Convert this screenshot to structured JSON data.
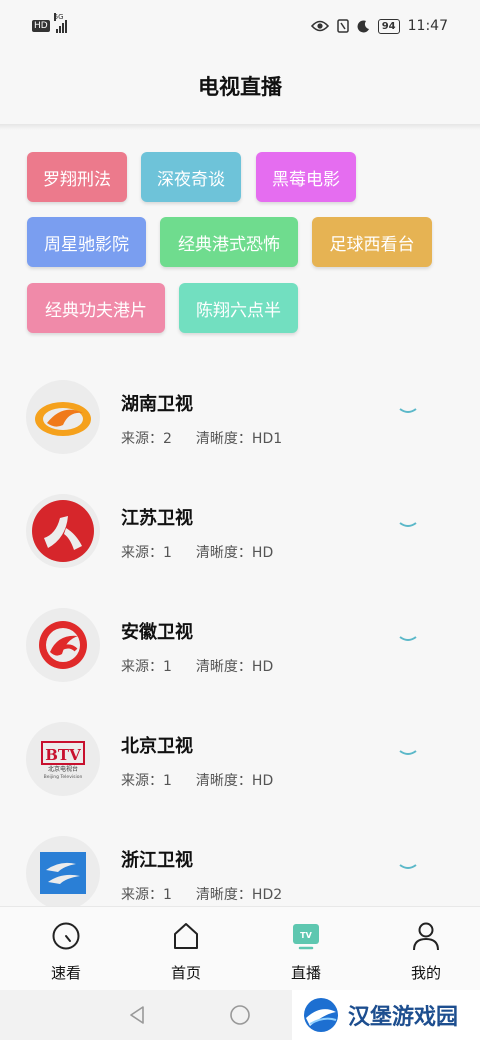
{
  "status_bar": {
    "network_badge": "HD",
    "network_type": "5G",
    "battery": "94",
    "time": "11:47"
  },
  "header": {
    "title": "电视直播"
  },
  "tags": [
    {
      "label": "罗翔刑法",
      "color": "#ec7a8c"
    },
    {
      "label": "深夜奇谈",
      "color": "#6ec3d9"
    },
    {
      "label": "黑莓电影",
      "color": "#e56df0"
    },
    {
      "label": "周星驰影院",
      "color": "#7a9ef0"
    },
    {
      "label": "经典港式恐怖",
      "color": "#6fdc8e"
    },
    {
      "label": "足球西看台",
      "color": "#e6b353"
    },
    {
      "label": "经典功夫港片",
      "color": "#f08aa9"
    },
    {
      "label": "陈翔六点半",
      "color": "#72dfc0"
    }
  ],
  "channels": [
    {
      "name": "湖南卫视",
      "source_label": "来源：",
      "source": "2",
      "quality_label": "清晰度：",
      "quality": "HD1",
      "logo": "hunan-tv-logo"
    },
    {
      "name": "江苏卫视",
      "source_label": "来源：",
      "source": "1",
      "quality_label": "清晰度：",
      "quality": "HD",
      "logo": "jiangsu-tv-logo"
    },
    {
      "name": "安徽卫视",
      "source_label": "来源：",
      "source": "1",
      "quality_label": "清晰度：",
      "quality": "HD",
      "logo": "anhui-tv-logo"
    },
    {
      "name": "北京卫视",
      "source_label": "来源：",
      "source": "1",
      "quality_label": "清晰度：",
      "quality": "HD",
      "logo": "beijing-tv-logo",
      "logo_text": {
        "brand": "BTV",
        "cn": "北京电视台",
        "en": "Beijing Television"
      }
    },
    {
      "name": "浙江卫视",
      "source_label": "来源：",
      "source": "1",
      "quality_label": "清晰度：",
      "quality": "HD2",
      "logo": "zhejiang-tv-logo"
    }
  ],
  "tabbar": {
    "tabs": [
      {
        "label": "速看",
        "icon": "clock-icon"
      },
      {
        "label": "首页",
        "icon": "home-icon"
      },
      {
        "label": "直播",
        "icon": "tv-icon",
        "active": true
      },
      {
        "label": "我的",
        "icon": "user-icon"
      }
    ]
  },
  "watermark": {
    "text": "汉堡游戏园"
  },
  "colors": {
    "accent": "#5ec7b0",
    "chevron": "#5bb8c9"
  }
}
